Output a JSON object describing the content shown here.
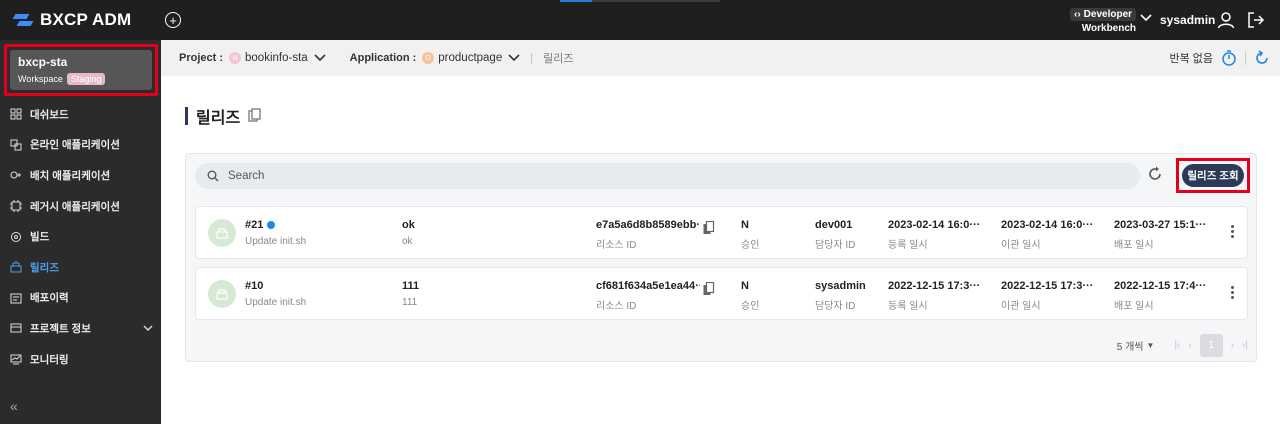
{
  "topbar": {
    "logo_text": "BXCP ADM",
    "dev_label": "Developer",
    "workbench_label": "Workbench",
    "username": "sysadmin"
  },
  "workspace": {
    "name": "bxcp-sta",
    "label": "Workspace",
    "badge": "Staging"
  },
  "sidebar": {
    "items": [
      {
        "label": "대쉬보드",
        "icon": "dashboard-icon"
      },
      {
        "label": "온라인 애플리케이션",
        "icon": "online-app-icon"
      },
      {
        "label": "배치 애플리케이션",
        "icon": "batch-app-icon"
      },
      {
        "label": "레거시 애플리케이션",
        "icon": "legacy-app-icon"
      },
      {
        "label": "빌드",
        "icon": "build-icon"
      },
      {
        "label": "릴리즈",
        "icon": "release-icon"
      },
      {
        "label": "배포이력",
        "icon": "deploy-history-icon"
      },
      {
        "label": "프로젝트 정보",
        "icon": "project-info-icon"
      },
      {
        "label": "모니터링",
        "icon": "monitoring-icon"
      }
    ],
    "active_index": 5
  },
  "breadcrumb": {
    "project_label": "Project :",
    "project_initial": "N",
    "project_value": "bookinfo-sta",
    "app_label": "Application :",
    "app_initial": "O",
    "app_value": "productpage",
    "current": "릴리즈",
    "repeat_label": "반복 없음"
  },
  "page": {
    "title": "릴리즈",
    "search_placeholder": "Search",
    "release_button": "릴리즈 조회"
  },
  "releases": [
    {
      "number": "#21",
      "new": true,
      "desc": "Update init.sh",
      "name": "ok",
      "name_sub": "ok",
      "resource_id": "e7a5a6d8b8589ebb···",
      "resource_label": "리소스 ID",
      "approval": "N",
      "approval_label": "승인",
      "owner": "dev001",
      "owner_label": "담당자 ID",
      "registered": "2023-02-14 16:0···",
      "registered_label": "등록 일시",
      "transferred": "2023-02-14 16:0···",
      "transferred_label": "이관 일시",
      "deployed": "2023-03-27 15:1···",
      "deployed_label": "배포 일시"
    },
    {
      "number": "#10",
      "new": false,
      "desc": "Update init.sh",
      "name": "111",
      "name_sub": "111",
      "resource_id": "cf681f634a5e1ea44···",
      "resource_label": "리소스 ID",
      "approval": "N",
      "approval_label": "승인",
      "owner": "sysadmin",
      "owner_label": "담당자 ID",
      "registered": "2022-12-15 17:3···",
      "registered_label": "등록 일시",
      "transferred": "2022-12-15 17:3···",
      "transferred_label": "이관 일시",
      "deployed": "2022-12-15 17:4···",
      "deployed_label": "배포 일시"
    }
  ],
  "pagination": {
    "per_page": "5 개씩",
    "current_page": "1"
  }
}
